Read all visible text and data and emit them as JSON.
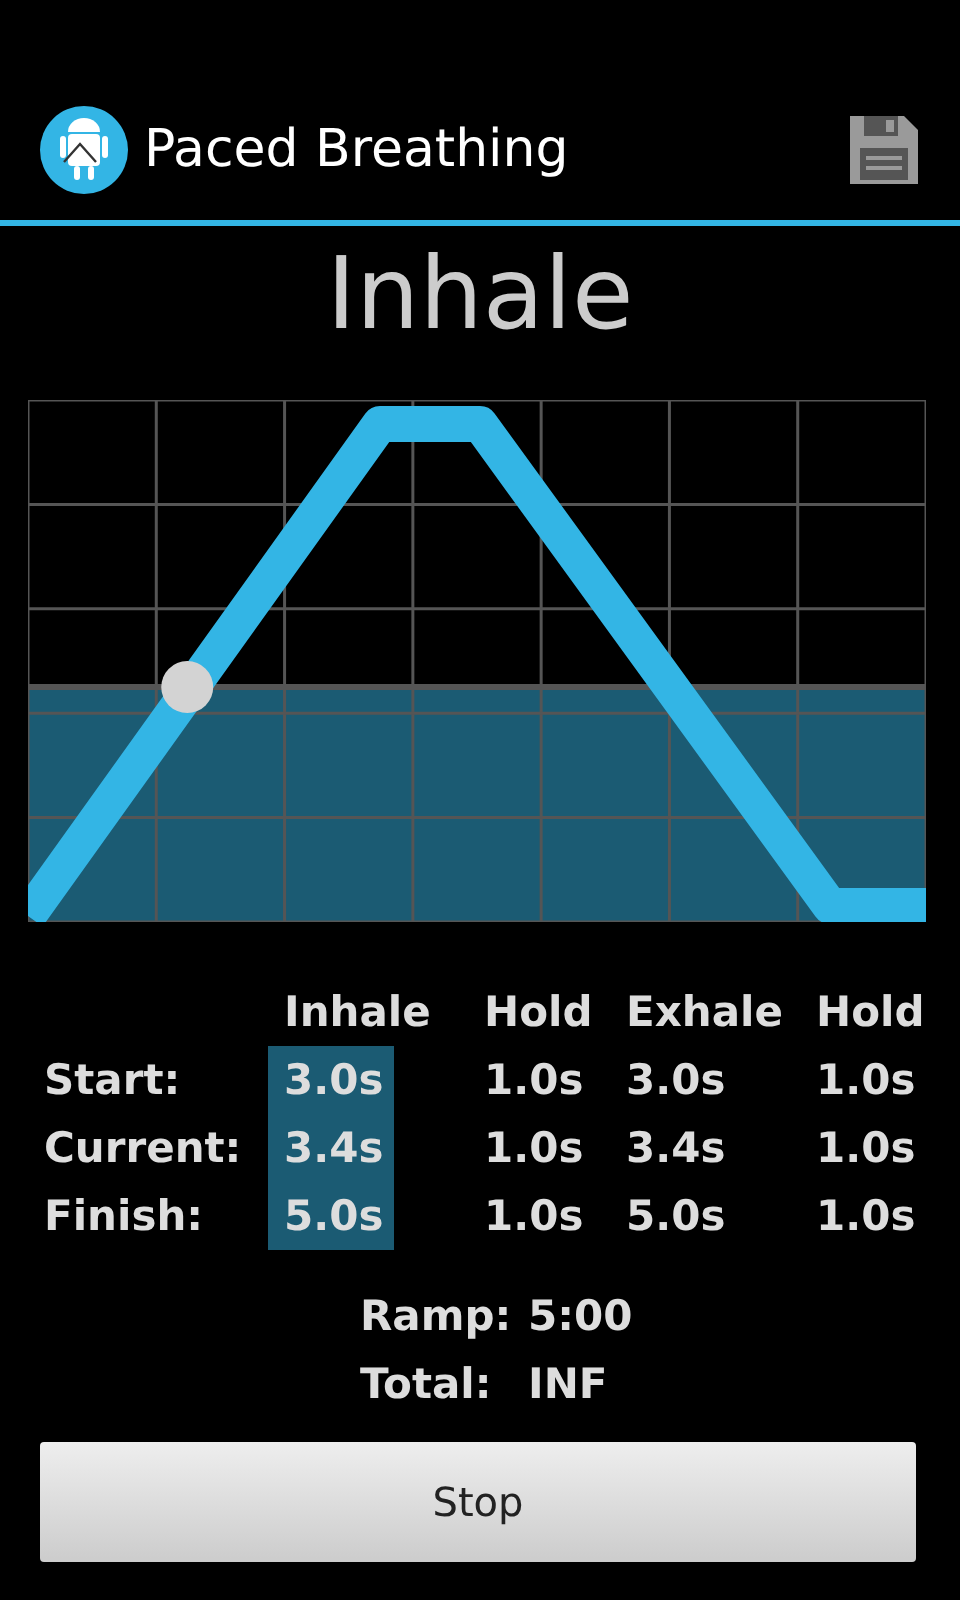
{
  "action_bar": {
    "title": "Paced Breathing"
  },
  "phase": "Inhale",
  "table": {
    "columns": [
      {
        "label": "Inhale",
        "selected": true
      },
      {
        "label": "Hold",
        "selected": false
      },
      {
        "label": "Exhale",
        "selected": false
      },
      {
        "label": "Hold",
        "selected": false
      }
    ],
    "rows": [
      {
        "label": "Start:",
        "cells": [
          "3.0s",
          "1.0s",
          "3.0s",
          "1.0s"
        ]
      },
      {
        "label": "Current:",
        "cells": [
          "3.4s",
          "1.0s",
          "3.4s",
          "1.0s"
        ]
      },
      {
        "label": "Finish:",
        "cells": [
          "5.0s",
          "1.0s",
          "5.0s",
          "1.0s"
        ]
      }
    ]
  },
  "summary": [
    {
      "label": "Ramp:",
      "value": "5:00"
    },
    {
      "label": "Total:",
      "value": "INF"
    }
  ],
  "button": "Stop"
}
